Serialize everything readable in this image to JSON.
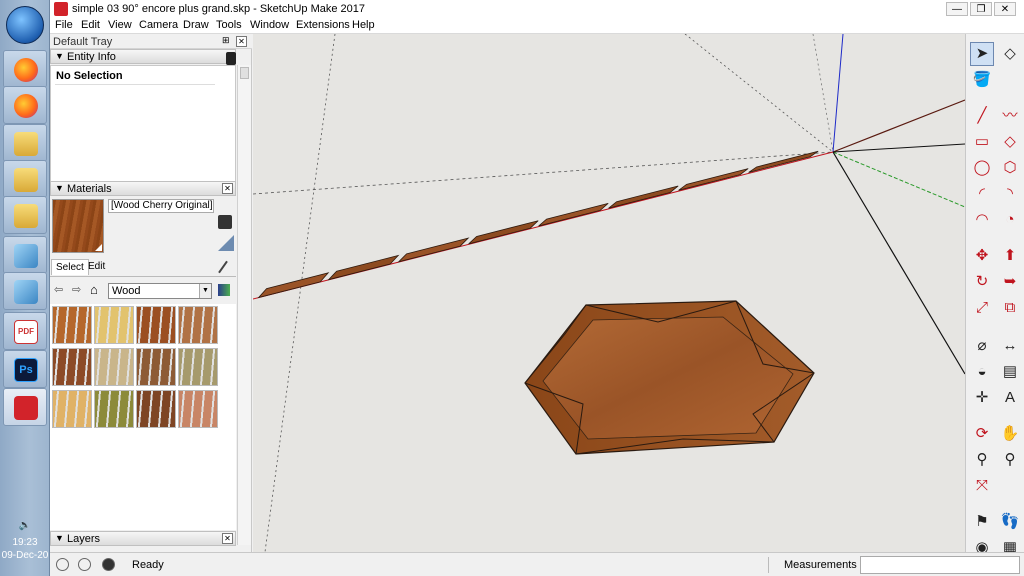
{
  "window": {
    "title": "simple 03 90° encore plus grand.skp - SketchUp Make 2017",
    "minimize": "—",
    "restore": "❐",
    "close": "✕"
  },
  "menu": [
    "File",
    "Edit",
    "View",
    "Camera",
    "Draw",
    "Tools",
    "Window",
    "Extensions",
    "Help"
  ],
  "taskbar": {
    "apps": [
      "firefox-icon",
      "firefox-icon",
      "folder-icon",
      "folder-icon",
      "folder-icon",
      "sketchup-viewer-icon",
      "sketchup-viewer-icon",
      "pdf-icon",
      "photoshop-icon",
      "sketchup-icon"
    ],
    "pdf_label": "PDF",
    "ps_label": "Ps",
    "volume_icon": "🔈",
    "time": "19:23",
    "date": "09-Dec-20"
  },
  "tray": {
    "title": "Default Tray",
    "pin": "⊞",
    "close": "✕",
    "entity_info": {
      "label": "Entity Info",
      "selection": "No Selection"
    },
    "materials": {
      "label": "Materials",
      "current_name": "[Wood Cherry Original]1",
      "tabs": [
        "Select",
        "Edit"
      ],
      "library": "Wood",
      "swatches": [
        "#b5672b",
        "#e2c36e",
        "#9b4f22",
        "#b07245",
        "#8c4a26",
        "#c9b58a",
        "#8d5b35",
        "#a69a6c",
        "#e0b266",
        "#8c8a3a",
        "#7e4524",
        "#c88566"
      ]
    },
    "layers": {
      "label": "Layers"
    }
  },
  "status": {
    "text": "Ready",
    "measurements_label": "Measurements",
    "measurements_value": ""
  },
  "colors": {
    "viewport_bg": "#e6e5e2",
    "wood_dark": "#7a3d15",
    "wood_mid": "#9c5428",
    "wood_light": "#b46a35",
    "axis_red": "#c0141e",
    "axis_green": "#2a9a2a",
    "axis_blue": "#1e2ac8"
  }
}
